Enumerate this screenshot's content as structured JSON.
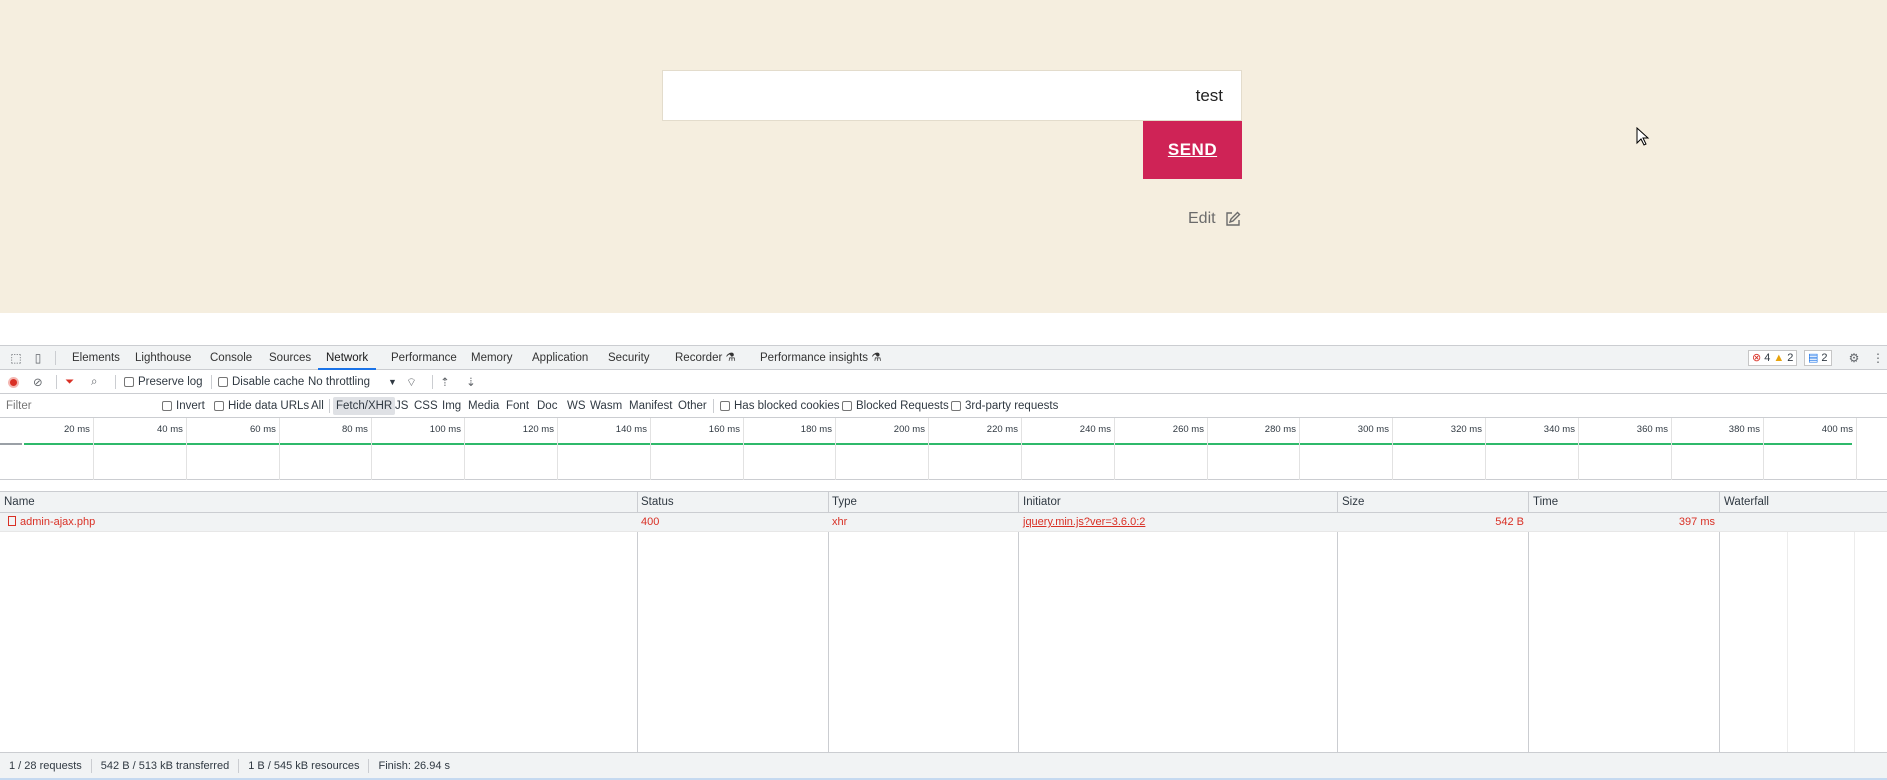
{
  "page": {
    "input_value": "test",
    "send_label": "SEND",
    "edit_label": "Edit"
  },
  "devtools": {
    "tabs": [
      "Elements",
      "Lighthouse",
      "Console",
      "Sources",
      "Network",
      "Performance",
      "Memory",
      "Application",
      "Security",
      "Recorder ⚗",
      "Performance insights ⚗"
    ],
    "active_tab": "Network",
    "badges": {
      "errors": "4",
      "warnings": "2",
      "messages": "2"
    },
    "toolbar": {
      "preserve_log": "Preserve log",
      "disable_cache": "Disable cache",
      "throttling": "No throttling"
    },
    "filterbar": {
      "filter_placeholder": "Filter",
      "invert": "Invert",
      "hide_data_urls": "Hide data URLs",
      "types": [
        "All",
        "Fetch/XHR",
        "JS",
        "CSS",
        "Img",
        "Media",
        "Font",
        "Doc",
        "WS",
        "Wasm",
        "Manifest",
        "Other"
      ],
      "active_type": "Fetch/XHR",
      "has_blocked_cookies": "Has blocked cookies",
      "blocked_requests": "Blocked Requests",
      "third_party": "3rd-party requests"
    },
    "overview_ticks": [
      "20 ms",
      "40 ms",
      "60 ms",
      "80 ms",
      "100 ms",
      "120 ms",
      "140 ms",
      "160 ms",
      "180 ms",
      "200 ms",
      "220 ms",
      "240 ms",
      "260 ms",
      "280 ms",
      "300 ms",
      "320 ms",
      "340 ms",
      "360 ms",
      "380 ms",
      "400 ms"
    ],
    "columns": [
      "Name",
      "Status",
      "Type",
      "Initiator",
      "Size",
      "Time",
      "Waterfall"
    ],
    "rows": [
      {
        "name": "admin-ajax.php",
        "status": "400",
        "type": "xhr",
        "initiator": "jquery.min.js?ver=3.6.0:2",
        "size": "542 B",
        "time": "397 ms"
      }
    ],
    "status_bar": {
      "requests": "1 / 28 requests",
      "transferred": "542 B / 513 kB transferred",
      "resources": "1 B / 545 kB resources",
      "finish": "Finish: 26.94 s"
    },
    "colors": {
      "error": "#d93025",
      "active_tab_underline": "#1a73e8"
    }
  }
}
